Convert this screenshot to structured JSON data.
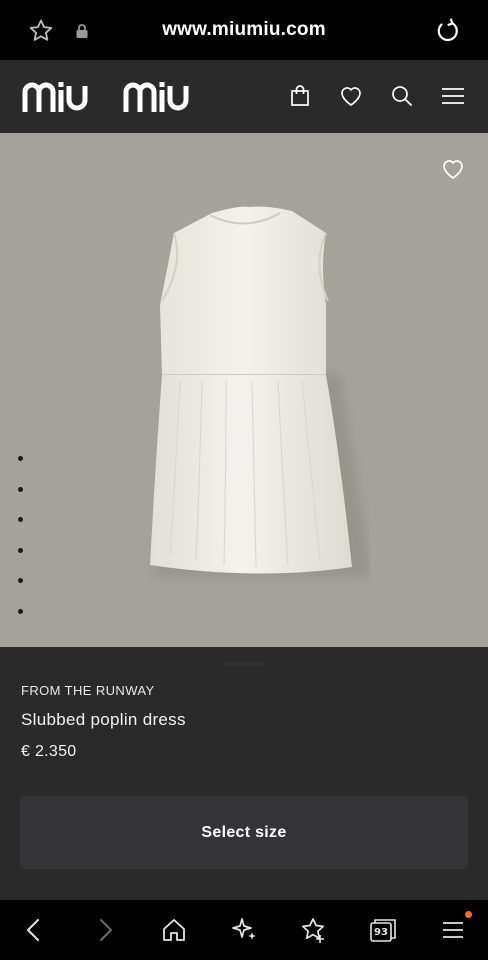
{
  "browser": {
    "url": "www.miumiu.com",
    "tabs_count": "93",
    "accent_color": "#ff6a2b"
  },
  "header": {
    "logo_text": "miu miu",
    "icons": [
      "shopping-bag-icon",
      "heart-icon",
      "search-icon",
      "menu-icon"
    ]
  },
  "hero": {
    "background_color": "#a5a29c",
    "carousel_dots": 6,
    "wishlist_icon": "heart-outline-icon"
  },
  "product": {
    "kicker": "FROM THE RUNWAY",
    "name": "Slubbed poplin dress",
    "price": "€ 2.350",
    "select_size_label": "Select size"
  },
  "bottom_nav": {
    "items": [
      "back-icon",
      "forward-icon",
      "home-icon",
      "sparkle-icon",
      "bookmarks-icon",
      "tabs-icon",
      "menu-icon"
    ]
  }
}
